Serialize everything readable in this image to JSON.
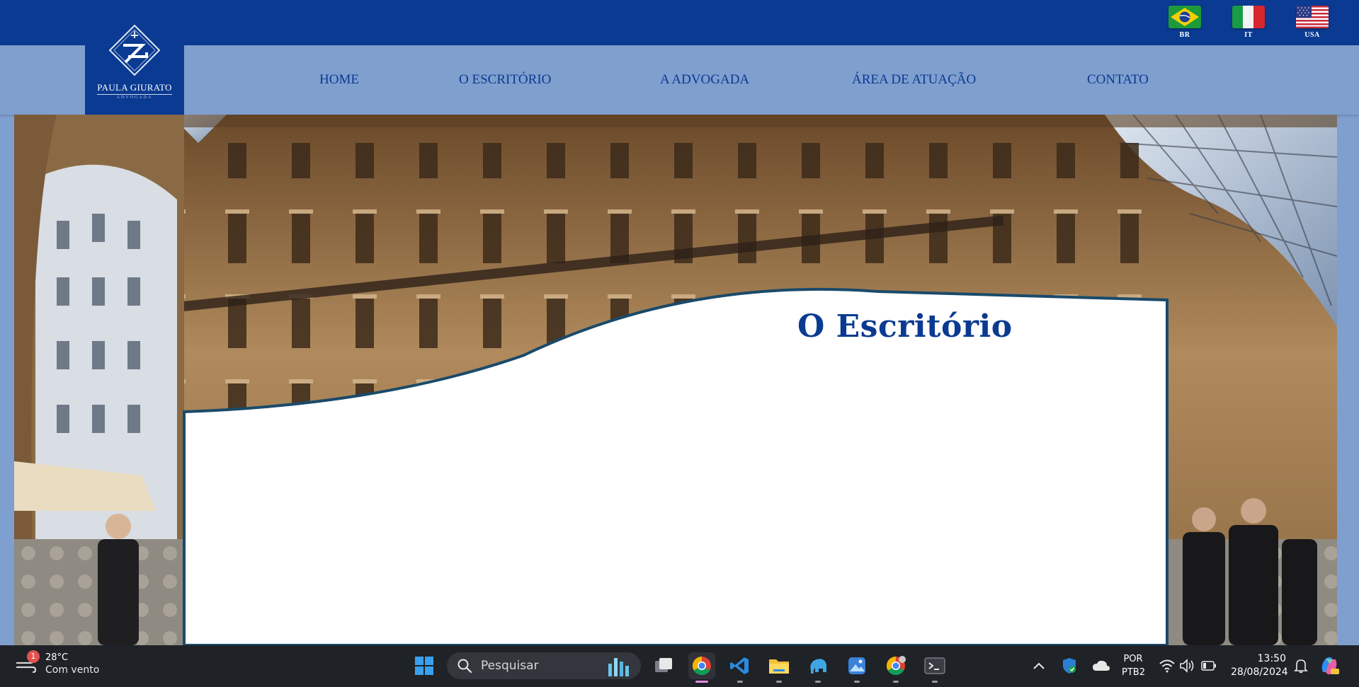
{
  "brand": {
    "name": "PAULA GIURATO",
    "subtitle": "ADVOGADA"
  },
  "flags": [
    {
      "code": "BR",
      "icon": "brazil-flag-icon"
    },
    {
      "code": "IT",
      "icon": "italy-flag-icon"
    },
    {
      "code": "USA",
      "icon": "usa-flag-icon"
    }
  ],
  "nav": {
    "items": [
      {
        "label": "HOME"
      },
      {
        "label": "O ESCRITÓRIO"
      },
      {
        "label": "A ADVOGADA"
      },
      {
        "label": "ÁREA DE ATUAÇÃO"
      },
      {
        "label": "CONTATO"
      }
    ]
  },
  "hero": {
    "heading": "O Escritório",
    "background": "galleria-vittorio-emanuele-photo"
  },
  "taskbar": {
    "weather": {
      "temperature": "28°C",
      "description": "Com vento",
      "badge": "1"
    },
    "search_placeholder": "Pesquisar",
    "apps": [
      "windows-start-icon",
      "search-icon",
      "task-view-icon",
      "chrome-icon",
      "vscode-icon",
      "file-explorer-icon",
      "elephant-app-icon",
      "photos-icon",
      "chrome-profile-icon",
      "terminal-icon"
    ],
    "language": {
      "line1": "POR",
      "line2": "PTB2"
    },
    "clock": {
      "time": "13:50",
      "date": "28/08/2024"
    }
  },
  "colors": {
    "brand_blue": "#0a3a91",
    "nav_bg": "#7f9fcf",
    "wave_border": "#1a4a6a",
    "taskbar_bg": "#1f2227"
  }
}
